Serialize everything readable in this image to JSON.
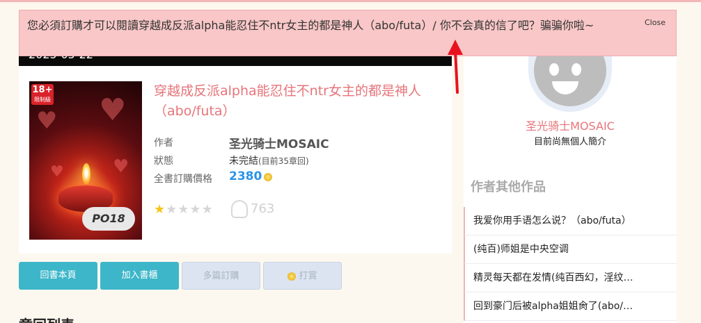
{
  "alert": {
    "message": "您必須訂購才可以閱讀穿越成反派alpha能忍住不ntr女主的都是神人（abo/futa）/ 你不会真的信了吧？骗骗你啦~",
    "close_label": "Close"
  },
  "header": {
    "date": "2025-05-22"
  },
  "book": {
    "badge_top": "18+",
    "badge_sub": "限制級",
    "cover_logo": "PO18",
    "title": "穿越成反派alpha能忍住不ntr女主的都是神人（abo/futa）",
    "author_label": "作者",
    "author": "圣光骑士MOSAIC",
    "status_label": "狀態",
    "status": "未完結",
    "status_detail": "(目前35章回)",
    "price_label": "全書訂購價格",
    "price": "2380",
    "rating": 1,
    "rating_max": 5,
    "views": "763"
  },
  "actions": {
    "back": "回書本頁",
    "add_shelf": "加入書櫃",
    "multi_order": "多篇訂購",
    "tip": "打賞"
  },
  "chapters": {
    "heading": "章回列表"
  },
  "sidebar": {
    "author_name": "圣光骑士MOSAIC",
    "author_bio": "目前尚無個人簡介",
    "other_works_heading": "作者其他作品",
    "works": [
      "我爱你用手语怎么说？（abo/futa）",
      "(纯百)师姐是中央空调",
      "精灵每天都在发情(纯百西幻，淫纹…",
      "回到豪门后被alpha姐姐肏了(abo/…"
    ]
  },
  "colors": {
    "alert_bg": "#f9c7c7",
    "accent_pink": "#e7747a",
    "button_teal": "#3db6c9",
    "price_blue": "#2a93e8",
    "arrow_red": "#e8121e"
  }
}
